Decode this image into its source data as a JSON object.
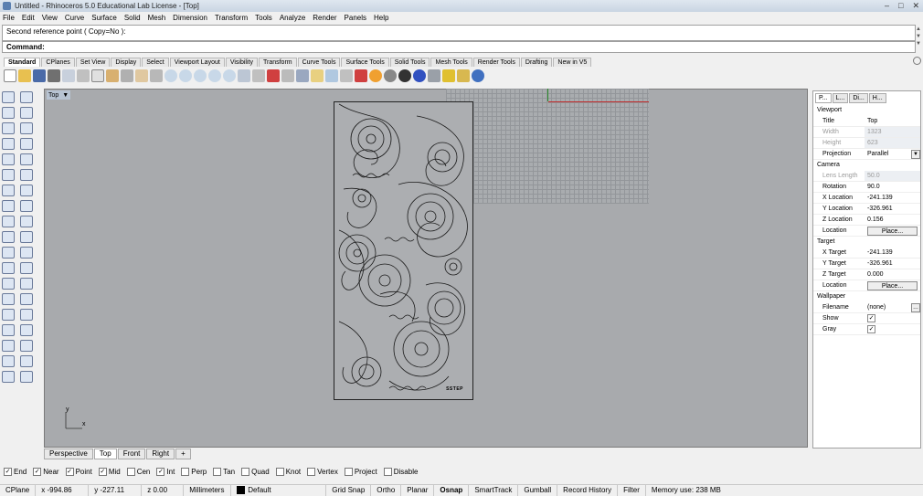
{
  "window": {
    "title": "Untitled - Rhinoceros 5.0 Educational Lab License - [Top]",
    "controls": [
      "–",
      "□",
      "✕"
    ]
  },
  "menu": [
    "File",
    "Edit",
    "View",
    "Curve",
    "Surface",
    "Solid",
    "Mesh",
    "Dimension",
    "Transform",
    "Tools",
    "Analyze",
    "Render",
    "Panels",
    "Help"
  ],
  "command": {
    "history": "Second reference point ( Copy=No ):",
    "prompt": "Command:"
  },
  "toolbar_tabs": [
    "Standard",
    "CPlanes",
    "Set View",
    "Display",
    "Select",
    "Viewport Layout",
    "Visibility",
    "Transform",
    "Curve Tools",
    "Surface Tools",
    "Solid Tools",
    "Mesh Tools",
    "Render Tools",
    "Drafting",
    "New in V5"
  ],
  "viewport": {
    "name": "Top",
    "tabs": [
      "Perspective",
      "Top",
      "Front",
      "Right",
      "+"
    ],
    "active_tab": "Top",
    "axis_labels": {
      "x": "x",
      "y": "y"
    },
    "panel_tag": "SSTEP"
  },
  "properties": {
    "tabs": [
      "P...",
      "L...",
      "Di...",
      "H..."
    ],
    "sections": {
      "viewport": "Viewport",
      "camera": "Camera",
      "target": "Target",
      "wallpaper": "Wallpaper"
    },
    "viewport_rows": [
      {
        "label": "Title",
        "value": "Top"
      },
      {
        "label": "Width",
        "value": "1323"
      },
      {
        "label": "Height",
        "value": "623"
      },
      {
        "label": "Projection",
        "value": "Parallel"
      }
    ],
    "camera_rows": [
      {
        "label": "Lens Length",
        "value": "50.0"
      },
      {
        "label": "Rotation",
        "value": "90.0"
      },
      {
        "label": "X Location",
        "value": "-241.139"
      },
      {
        "label": "Y Location",
        "value": "-326.961"
      },
      {
        "label": "Z Location",
        "value": "0.156"
      },
      {
        "label": "Location",
        "value": "Place..."
      }
    ],
    "target_rows": [
      {
        "label": "X Target",
        "value": "-241.139"
      },
      {
        "label": "Y Target",
        "value": "-326.961"
      },
      {
        "label": "Z Target",
        "value": "0.000"
      },
      {
        "label": "Location",
        "value": "Place..."
      }
    ],
    "wallpaper_rows": [
      {
        "label": "Filename",
        "value": "(none)"
      },
      {
        "label": "Show",
        "value": "✓"
      },
      {
        "label": "Gray",
        "value": "✓"
      }
    ]
  },
  "osnap": [
    {
      "label": "End",
      "checked": "✓"
    },
    {
      "label": "Near",
      "checked": "✓"
    },
    {
      "label": "Point",
      "checked": "✓"
    },
    {
      "label": "Mid",
      "checked": "✓"
    },
    {
      "label": "Cen",
      "checked": ""
    },
    {
      "label": "Int",
      "checked": "✓"
    },
    {
      "label": "Perp",
      "checked": ""
    },
    {
      "label": "Tan",
      "checked": ""
    },
    {
      "label": "Quad",
      "checked": ""
    },
    {
      "label": "Knot",
      "checked": ""
    },
    {
      "label": "Vertex",
      "checked": ""
    },
    {
      "label": "Project",
      "checked": ""
    },
    {
      "label": "Disable",
      "checked": ""
    }
  ],
  "status": {
    "cplane": "CPlane",
    "x": "x -994.86",
    "y": "y -227.11",
    "z": "z 0.00",
    "units": "Millimeters",
    "layer": "Default",
    "toggles": [
      "Grid Snap",
      "Ortho",
      "Planar",
      "Osnap",
      "SmartTrack",
      "Gumball",
      "Record History",
      "Filter"
    ],
    "active_toggle": "Osnap",
    "memory": "Memory use: 238 MB"
  }
}
